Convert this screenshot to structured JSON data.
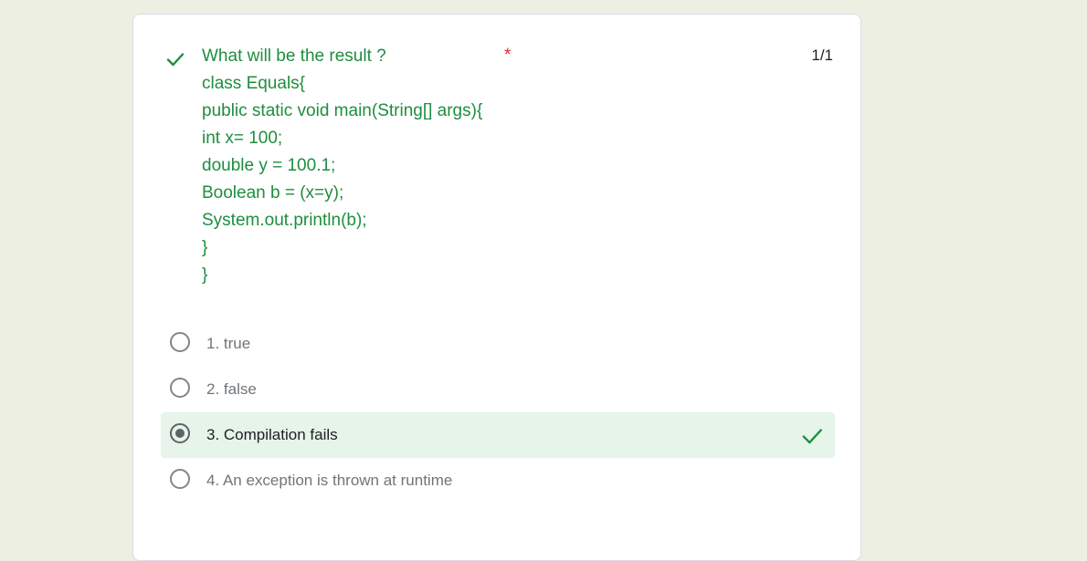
{
  "question": {
    "lines": [
      "What will be the result ?",
      "class Equals{",
      "public static void main(String[] args){",
      "int x= 100;",
      "double y = 100.1;",
      "Boolean b = (x=y);",
      "System.out.println(b);",
      "}",
      "}"
    ],
    "required_marker": "*",
    "score": "1/1",
    "status_icon": "check-icon"
  },
  "options": [
    {
      "label": "1. true",
      "selected": false,
      "correct": false
    },
    {
      "label": "2. false",
      "selected": false,
      "correct": false
    },
    {
      "label": "3. Compilation fails",
      "selected": true,
      "correct": true
    },
    {
      "label": "4. An exception is thrown at runtime",
      "selected": false,
      "correct": false
    }
  ],
  "colors": {
    "correct_green": "#1e8e3e",
    "correct_bg": "#e6f4ea",
    "required_red": "#d93025",
    "page_bg": "#ecefe2"
  }
}
